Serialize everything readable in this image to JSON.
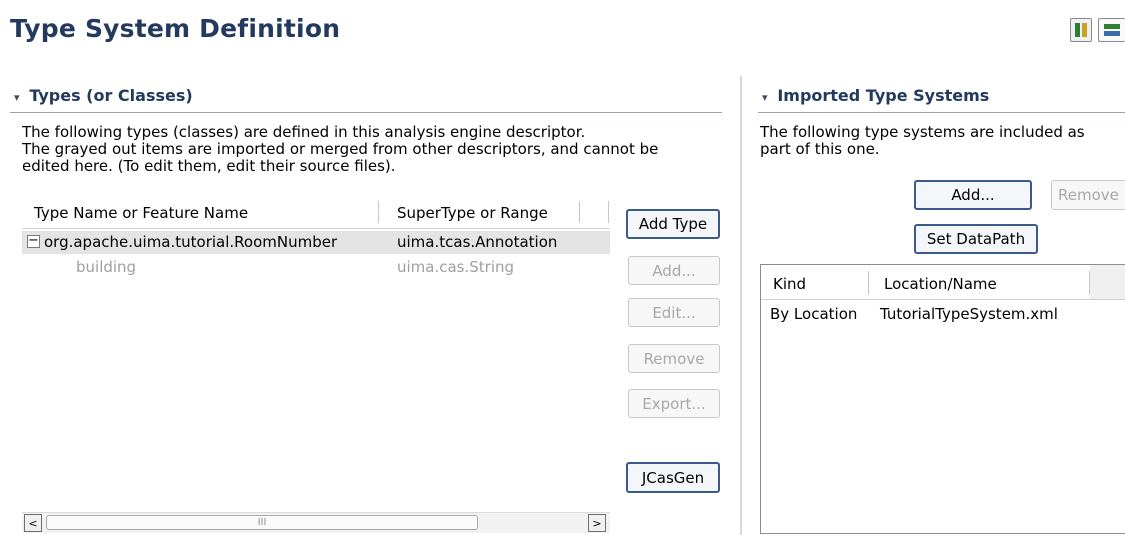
{
  "page": {
    "title": "Type System Definition"
  },
  "types_section": {
    "title": "Types (or Classes)",
    "description": [
      "The following types (classes) are defined in this analysis engine descriptor.",
      "The grayed out items are imported or merged from other descriptors, and cannot be",
      "edited here. (To edit them, edit their source files)."
    ],
    "columns": [
      "Type Name or Feature Name",
      "SuperType or Range"
    ],
    "rows": [
      {
        "name": "org.apache.uima.tutorial.RoomNumber",
        "range": "uima.tcas.Annotation",
        "expander": "−",
        "grayed": false
      },
      {
        "name": "building",
        "range": "uima.cas.String",
        "grayed": true
      }
    ],
    "buttons": {
      "add_type": "Add Type",
      "add": "Add...",
      "edit": "Edit...",
      "remove": "Remove",
      "export": "Export...",
      "jcasgen": "JCasGen"
    },
    "scrollbar": {
      "left": "<",
      "right": ">",
      "thumb_grip": "III"
    }
  },
  "imported_section": {
    "title": "Imported Type Systems",
    "description": [
      "The following type systems are included as",
      "part of this one."
    ],
    "buttons": {
      "add": "Add...",
      "remove": "Remove",
      "set_datapath": "Set DataPath"
    },
    "columns": [
      "Kind",
      "Location/Name"
    ],
    "rows": [
      {
        "kind": "By Location",
        "location": "TutorialTypeSystem.xml"
      }
    ]
  },
  "icons": {
    "layout_columns": "layout-columns-icon",
    "layout_rows": "layout-rows-icon",
    "twisty": "▾"
  },
  "colors": {
    "title": "#233a5e",
    "selected_row": "#e4e4e4",
    "grayed_text": "#a0a0a0",
    "button_border": "#7f9db9"
  }
}
